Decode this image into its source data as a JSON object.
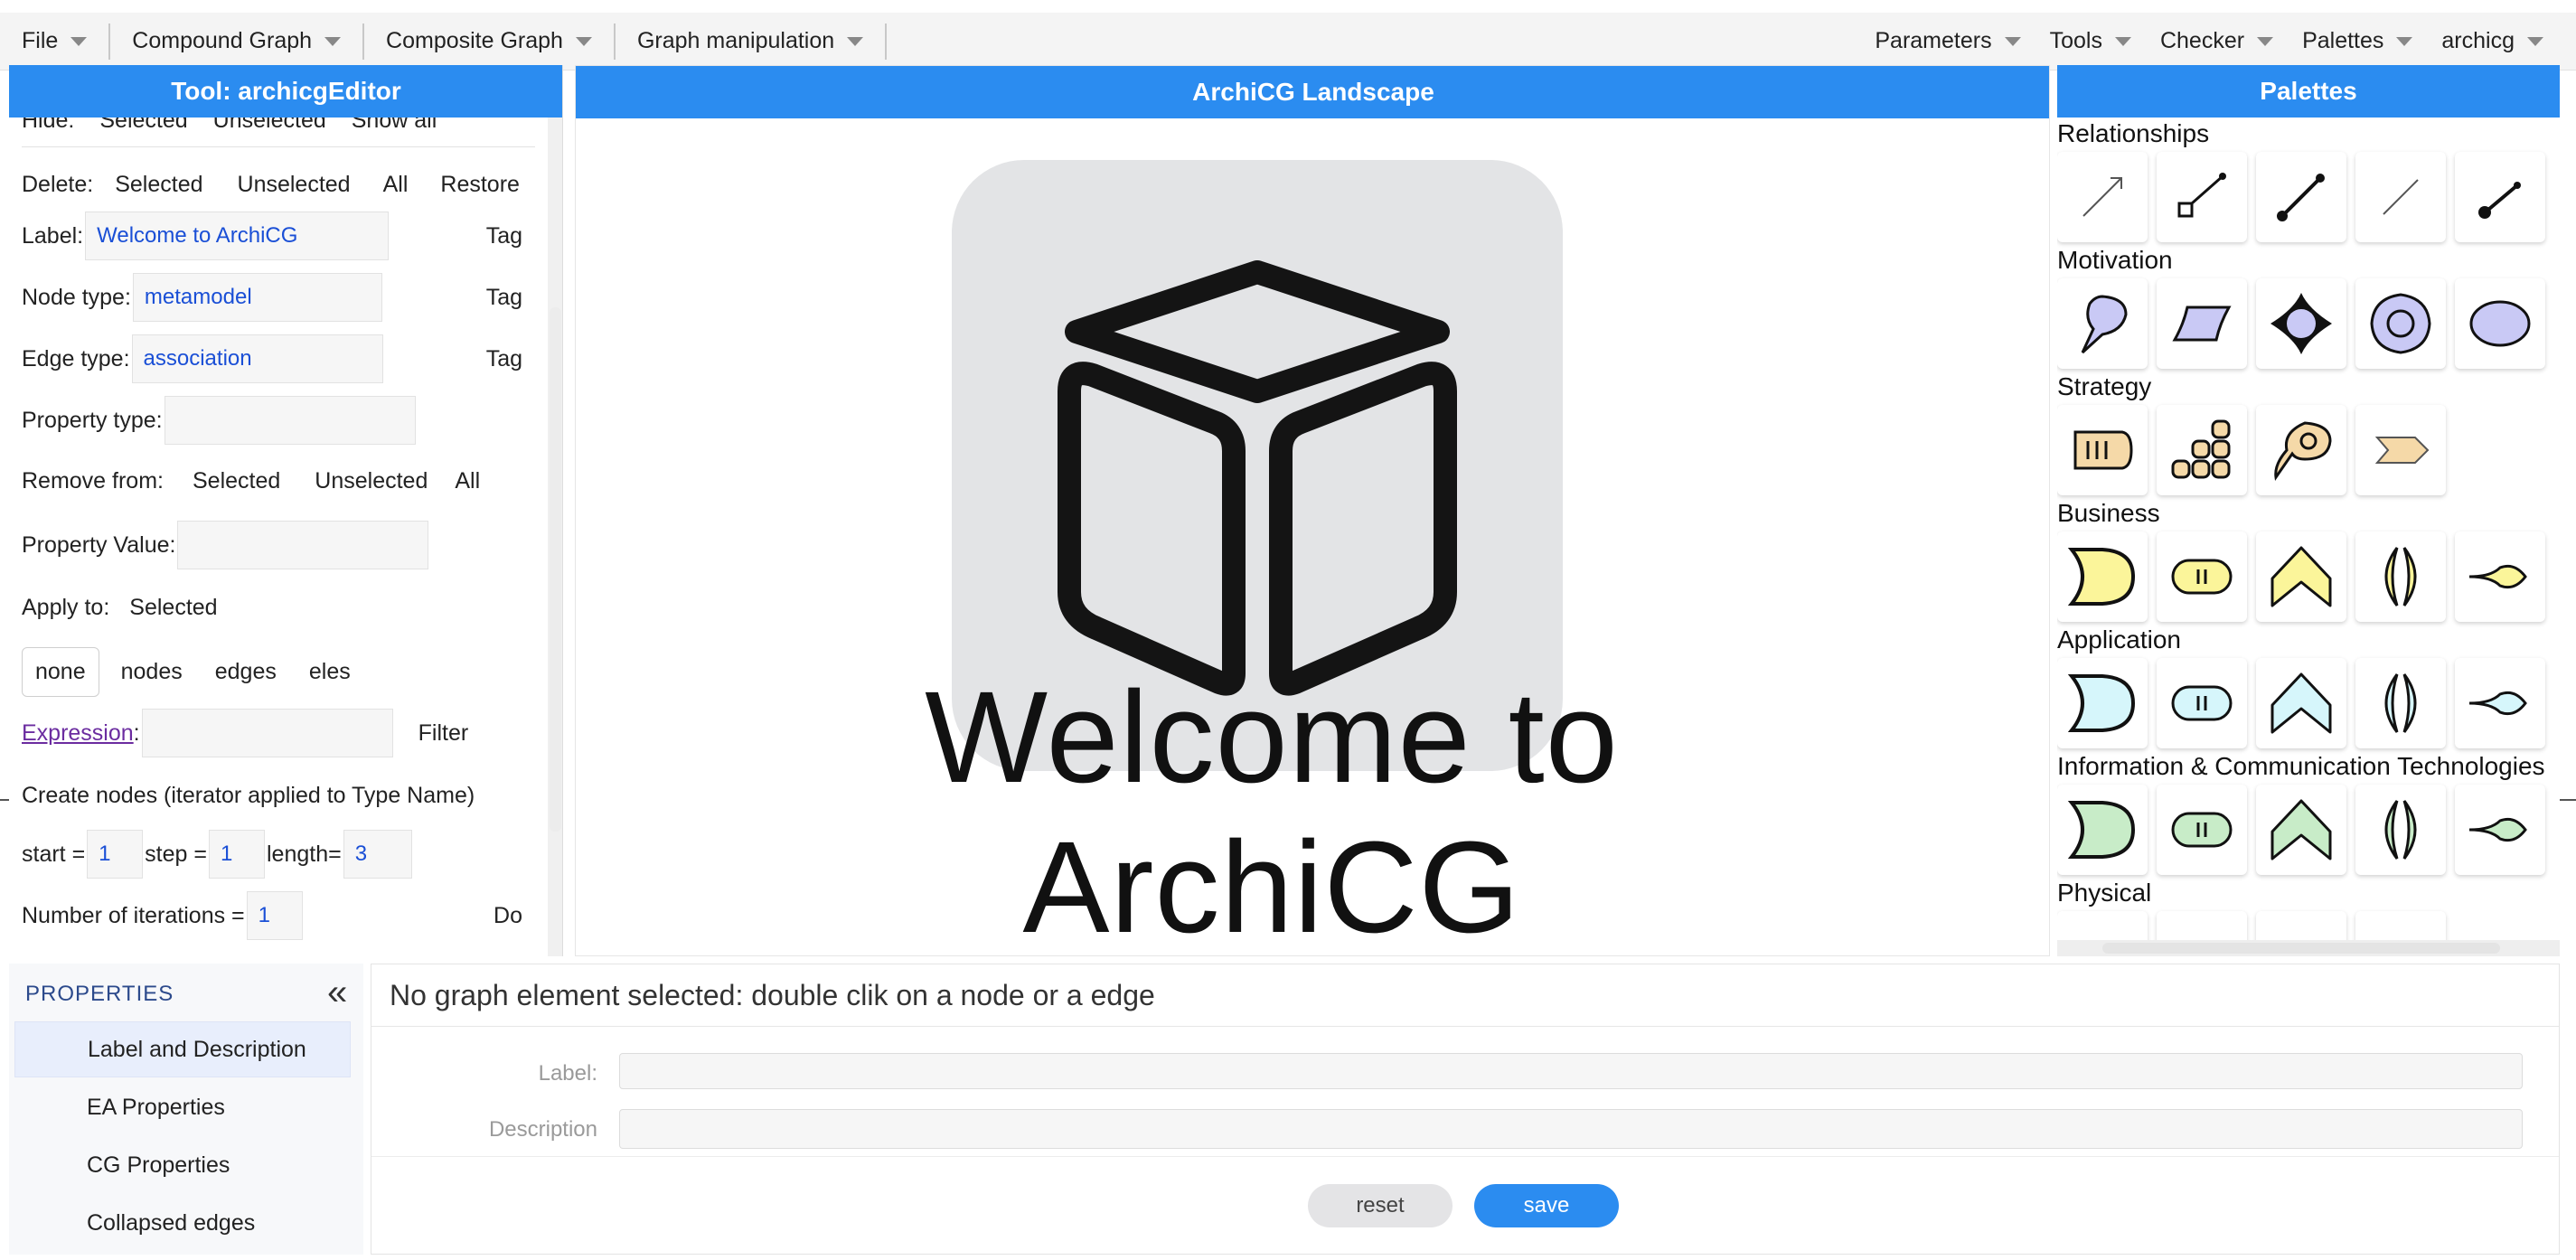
{
  "menubar": {
    "left": [
      "File",
      "Compound Graph",
      "Composite Graph",
      "Graph manipulation"
    ],
    "right": [
      "Parameters",
      "Tools",
      "Checker",
      "Palettes",
      "archicg"
    ]
  },
  "tool": {
    "title": "Tool: archicgEditor",
    "hide_label": "Hide:",
    "hide_opts": [
      "Selected",
      "Unselected",
      "Show all"
    ],
    "delete_label": "Delete:",
    "delete_opts": [
      "Selected",
      "Unselected",
      "All",
      "Restore"
    ],
    "label_label": "Label:",
    "label_value": "Welcome to ArchiCG",
    "node_type_label": "Node type:",
    "node_type_value": "metamodel",
    "edge_type_label": "Edge type:",
    "edge_type_value": "association",
    "tag": "Tag",
    "property_type_label": "Property type:",
    "remove_from_label": "Remove from:",
    "remove_from_opts": [
      "Selected",
      "Unselected",
      "All"
    ],
    "property_value_label": "Property Value:",
    "apply_to_label": "Apply to:",
    "apply_to_value": "Selected",
    "scope_opts": [
      "none",
      "nodes",
      "edges",
      "eles"
    ],
    "expression_label": "Expression",
    "colon": ":",
    "filter": "Filter",
    "create_nodes_label": "Create nodes (iterator applied to Type Name)",
    "start_label": "start =",
    "start_value": "1",
    "step_label": "step =",
    "step_value": "1",
    "length_label": "length=",
    "length_value": "3",
    "iterations_label": "Number of iterations =",
    "iterations_value": "1",
    "do": "Do"
  },
  "canvas": {
    "title": "ArchiCG Landscape",
    "welcome": "Welcome to ArchiCG"
  },
  "palettes": {
    "title": "Palettes",
    "sections": [
      "Relationships",
      "Motivation",
      "Strategy",
      "Business",
      "Application",
      "Information & Communication Technologies",
      "Physical"
    ],
    "colors": {
      "motivation": "#c9c9f5",
      "strategy": "#f5d9a8",
      "business": "#fbf59a",
      "application": "#d6f6fb",
      "ict": "#c8ecc8"
    }
  },
  "properties": {
    "title": "PROPERTIES",
    "collapse": "«",
    "items": [
      "Label and Description",
      "EA Properties",
      "CG Properties",
      "Collapsed edges"
    ],
    "message": "No graph element selected: double clik on a node or a edge",
    "label_field": "Label:",
    "description_field": "Description",
    "reset": "reset",
    "save": "save"
  }
}
